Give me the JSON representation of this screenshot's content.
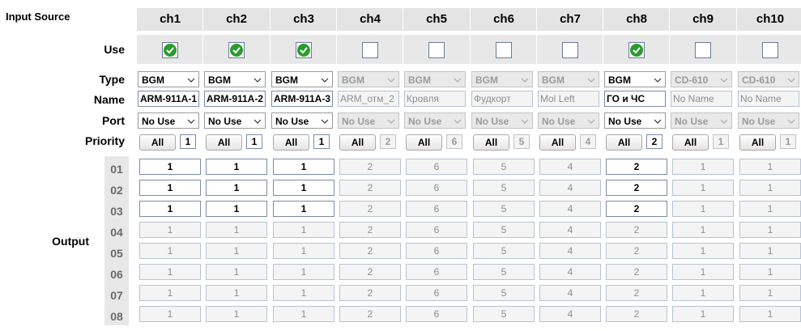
{
  "title": "Input Source",
  "labels": {
    "use": "Use",
    "type": "Type",
    "name": "Name",
    "port": "Port",
    "priority": "Priority",
    "output": "Output",
    "all": "All"
  },
  "output_rows": [
    "01",
    "02",
    "03",
    "04",
    "05",
    "06",
    "07",
    "08"
  ],
  "channels": [
    {
      "label": "ch1",
      "use": true,
      "enabled": true,
      "type": "BGM",
      "name": "ARM-911A-1",
      "port": "No Use",
      "priority": "1",
      "outputs": [
        "1",
        "1",
        "1",
        "1",
        "1",
        "1",
        "1",
        "1"
      ],
      "active_rows": 3
    },
    {
      "label": "ch2",
      "use": true,
      "enabled": true,
      "type": "BGM",
      "name": "ARM-911A-2",
      "port": "No Use",
      "priority": "1",
      "outputs": [
        "1",
        "1",
        "1",
        "1",
        "1",
        "1",
        "1",
        "1"
      ],
      "active_rows": 3
    },
    {
      "label": "ch3",
      "use": true,
      "enabled": true,
      "type": "BGM",
      "name": "ARM-911A-3",
      "port": "No Use",
      "priority": "1",
      "outputs": [
        "1",
        "1",
        "1",
        "1",
        "1",
        "1",
        "1",
        "1"
      ],
      "active_rows": 3
    },
    {
      "label": "ch4",
      "use": false,
      "enabled": false,
      "type": "BGM",
      "name": "ARM_отм_2",
      "port": "No Use",
      "priority": "2",
      "outputs": [
        "2",
        "2",
        "2",
        "2",
        "2",
        "2",
        "2",
        "2"
      ],
      "active_rows": 0
    },
    {
      "label": "ch5",
      "use": false,
      "enabled": false,
      "type": "BGM",
      "name": "Кровля",
      "port": "No Use",
      "priority": "6",
      "outputs": [
        "6",
        "6",
        "6",
        "6",
        "6",
        "6",
        "6",
        "6"
      ],
      "active_rows": 0
    },
    {
      "label": "ch6",
      "use": false,
      "enabled": false,
      "type": "BGM",
      "name": "Фудкорт",
      "port": "No Use",
      "priority": "5",
      "outputs": [
        "5",
        "5",
        "5",
        "5",
        "5",
        "5",
        "5",
        "5"
      ],
      "active_rows": 0
    },
    {
      "label": "ch7",
      "use": false,
      "enabled": false,
      "type": "BGM",
      "name": "Mol Left",
      "port": "No Use",
      "priority": "4",
      "outputs": [
        "4",
        "4",
        "4",
        "4",
        "4",
        "4",
        "4",
        "4"
      ],
      "active_rows": 0
    },
    {
      "label": "ch8",
      "use": true,
      "enabled": true,
      "type": "BGM",
      "name": "ГО и ЧС",
      "port": "No Use",
      "priority": "2",
      "outputs": [
        "2",
        "2",
        "2",
        "2",
        "2",
        "2",
        "2",
        "2"
      ],
      "active_rows": 3
    },
    {
      "label": "ch9",
      "use": false,
      "enabled": false,
      "type": "CD-610",
      "name": "No Name",
      "port": "No Use",
      "priority": "1",
      "outputs": [
        "1",
        "1",
        "1",
        "1",
        "1",
        "1",
        "1",
        "1"
      ],
      "active_rows": 0
    },
    {
      "label": "ch10",
      "use": false,
      "enabled": false,
      "type": "CD-610",
      "name": "No Name",
      "port": "No Use",
      "priority": "1",
      "outputs": [
        "1",
        "1",
        "1",
        "1",
        "1",
        "1",
        "1",
        "1"
      ],
      "active_rows": 0
    }
  ]
}
